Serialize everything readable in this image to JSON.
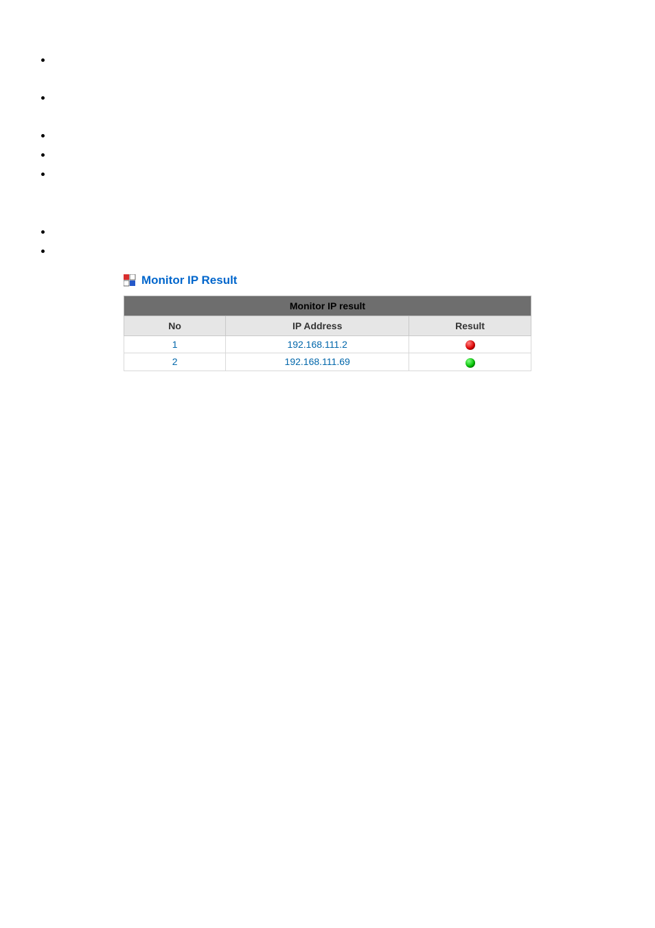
{
  "bullets": {
    "count": 7,
    "positions": [
      0,
      55,
      110,
      138,
      166,
      250,
      278
    ]
  },
  "section": {
    "title": "Monitor IP Result"
  },
  "table": {
    "caption": "Monitor IP result",
    "columns": [
      "No",
      "IP Address",
      "Result"
    ],
    "rows": [
      {
        "no": "1",
        "ip": "192.168.111.2",
        "status": "red"
      },
      {
        "no": "2",
        "ip": "192.168.111.69",
        "status": "green"
      }
    ]
  }
}
